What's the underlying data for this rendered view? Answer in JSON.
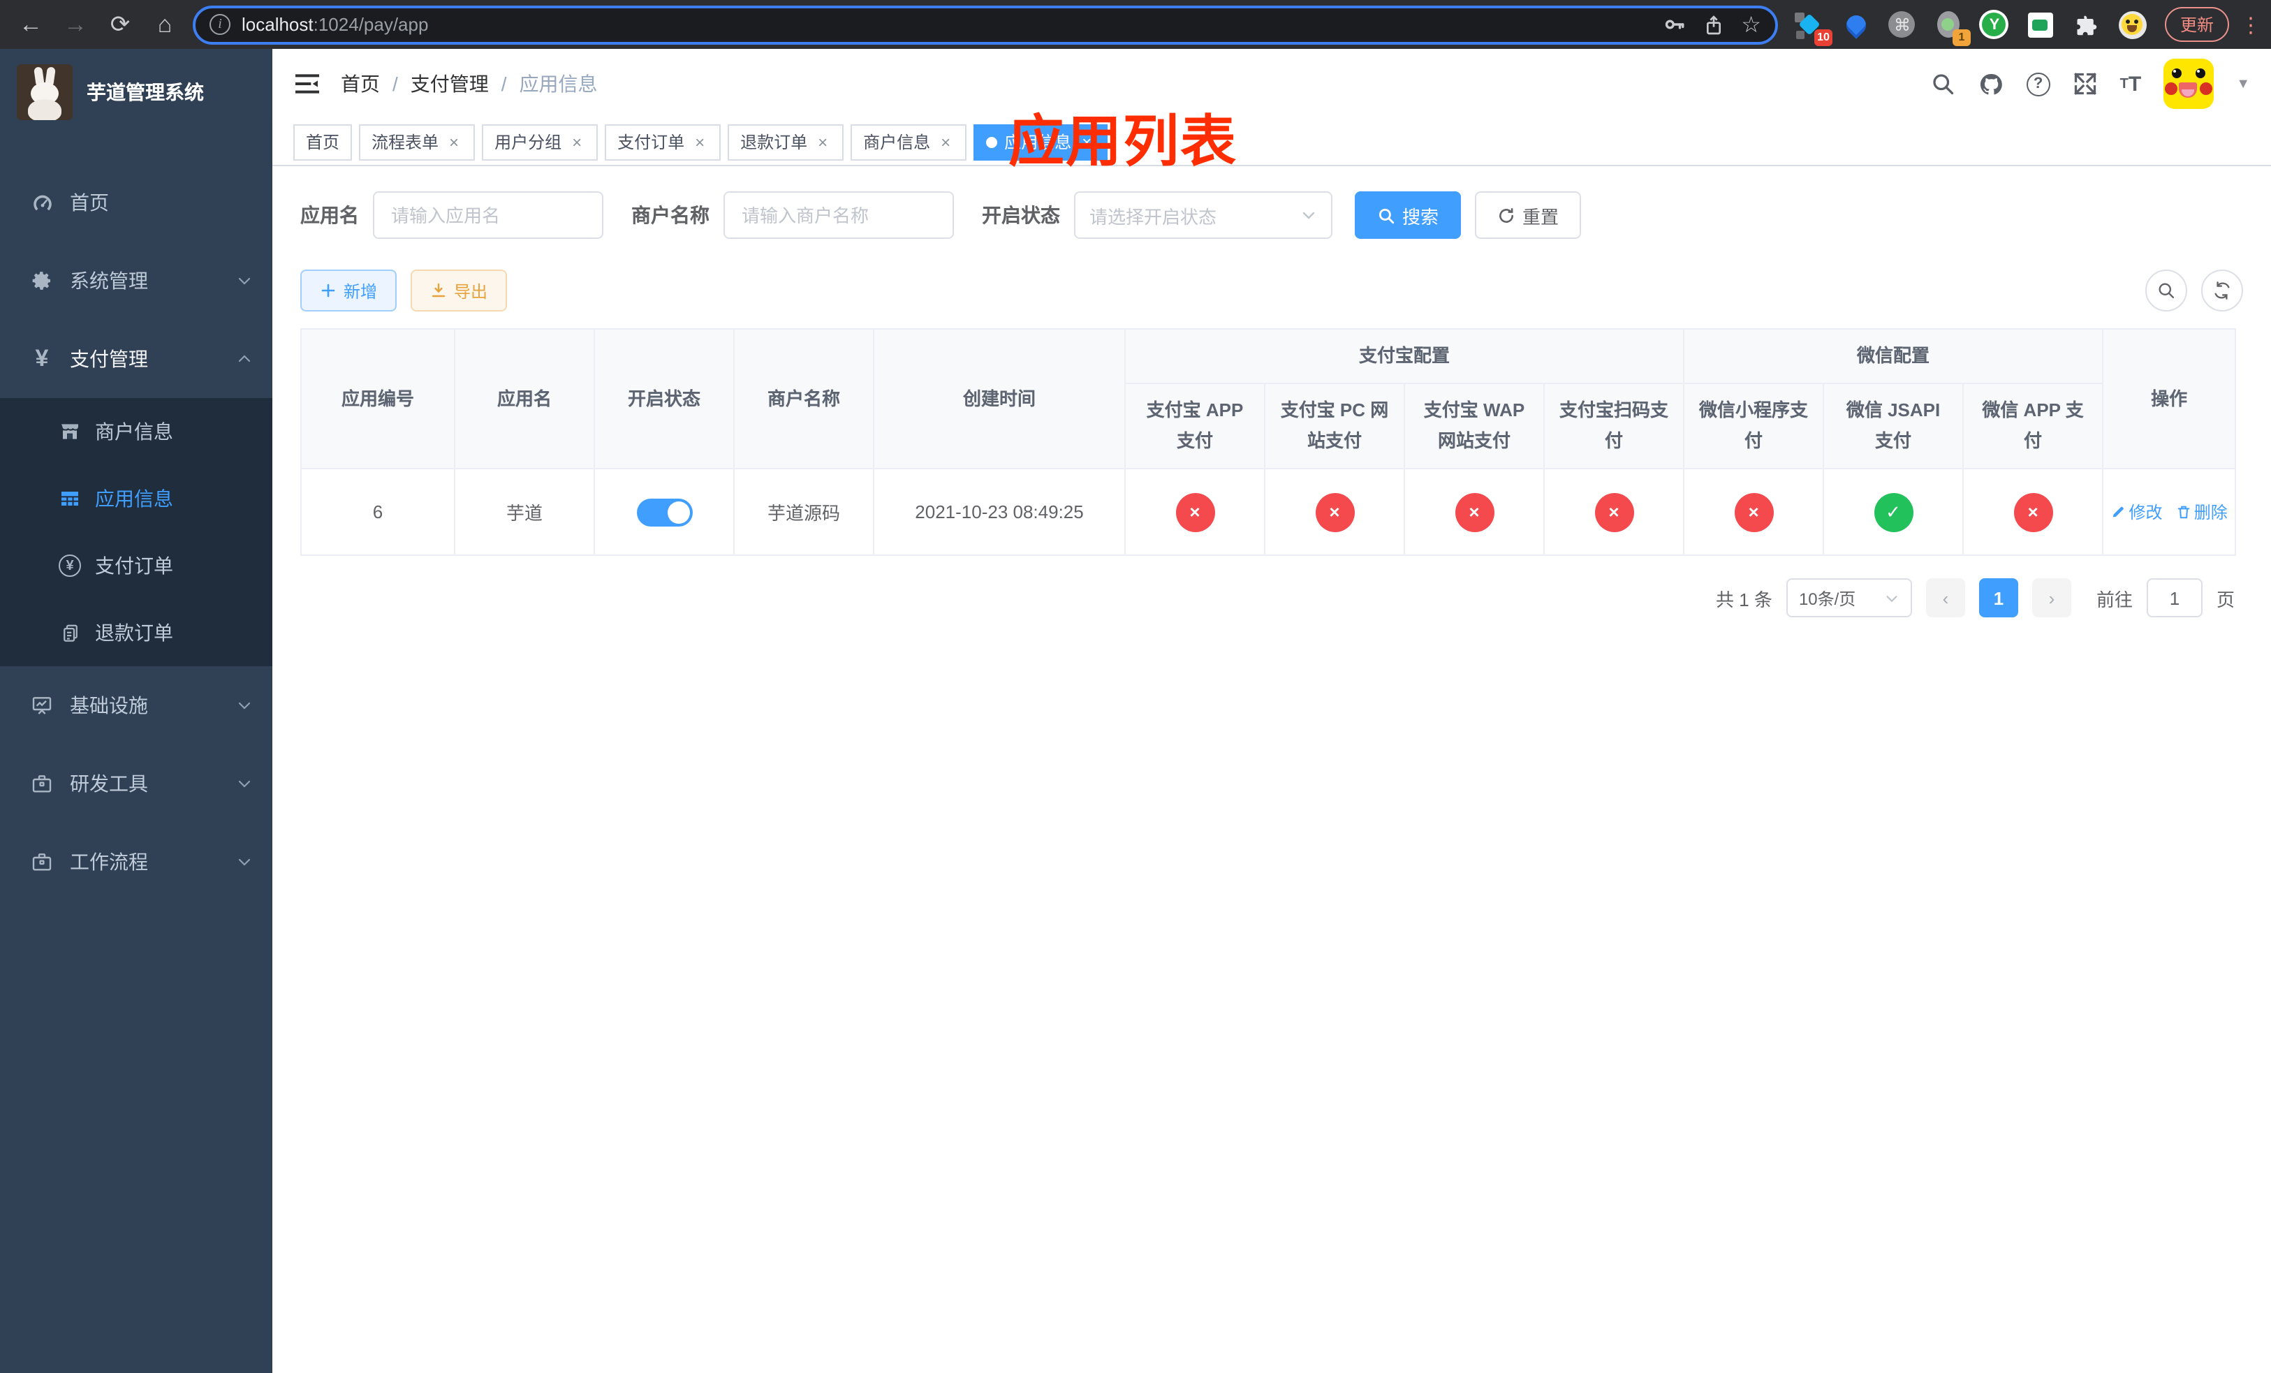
{
  "browser": {
    "url_host": "localhost",
    "url_rest": ":1024/pay/app",
    "update_button": "更新",
    "ext_badge_blue": "10",
    "ext_badge_green": "1",
    "toolbar_icons": [
      "back-icon",
      "forward-icon",
      "reload-icon",
      "home-icon",
      "info-icon",
      "key-icon",
      "share-icon",
      "star-icon",
      "extensions",
      "menu-kebab-icon"
    ]
  },
  "sidebar": {
    "title": "芋道管理系统",
    "items": [
      {
        "icon": "gauge",
        "label": "首页",
        "type": "item"
      },
      {
        "icon": "gear",
        "label": "系统管理",
        "type": "item",
        "chevron": "down"
      },
      {
        "icon": "yen",
        "label": "支付管理",
        "type": "item",
        "chevron": "up",
        "active_parent": true
      },
      {
        "icon": "store",
        "label": "商户信息",
        "type": "sub"
      },
      {
        "icon": "grid",
        "label": "应用信息",
        "type": "sub",
        "active": true
      },
      {
        "icon": "yen-circle",
        "label": "支付订单",
        "type": "sub"
      },
      {
        "icon": "doc",
        "label": "退款订单",
        "type": "sub"
      },
      {
        "icon": "monitor",
        "label": "基础设施",
        "type": "item",
        "chevron": "down"
      },
      {
        "icon": "briefcase",
        "label": "研发工具",
        "type": "item",
        "chevron": "down"
      },
      {
        "icon": "briefcase",
        "label": "工作流程",
        "type": "item",
        "chevron": "down"
      }
    ]
  },
  "header": {
    "breadcrumb": [
      "首页",
      "支付管理",
      "应用信息"
    ],
    "annotation": "应用列表",
    "right_icons": [
      "search-icon",
      "github-icon",
      "help-icon",
      "fullscreen-icon",
      "font-size-icon",
      "user-avatar",
      "chevron-down-icon"
    ]
  },
  "tabs": [
    {
      "label": "首页",
      "closable": false,
      "active": false
    },
    {
      "label": "流程表单",
      "closable": true,
      "active": false
    },
    {
      "label": "用户分组",
      "closable": true,
      "active": false
    },
    {
      "label": "支付订单",
      "closable": true,
      "active": false
    },
    {
      "label": "退款订单",
      "closable": true,
      "active": false
    },
    {
      "label": "商户信息",
      "closable": true,
      "active": false
    },
    {
      "label": "应用信息",
      "closable": true,
      "active": true
    }
  ],
  "filters": {
    "app_name_label": "应用名",
    "app_name_placeholder": "请输入应用名",
    "merchant_label": "商户名称",
    "merchant_placeholder": "请输入商户名称",
    "status_label": "开启状态",
    "status_placeholder": "请选择开启状态",
    "search_button": "搜索",
    "reset_button": "重置"
  },
  "actions": {
    "add": "新增",
    "export": "导出"
  },
  "table": {
    "columns": [
      "应用编号",
      "应用名",
      "开启状态",
      "商户名称",
      "创建时间"
    ],
    "groups": [
      {
        "label": "支付宝配置",
        "span": 4
      },
      {
        "label": "微信配置",
        "span": 3
      }
    ],
    "pay_columns": [
      "支付宝 APP 支付",
      "支付宝 PC 网站支付",
      "支付宝 WAP 网站支付",
      "支付宝扫码支付",
      "微信小程序支付",
      "微信 JSAPI 支付",
      "微信 APP 支付"
    ],
    "op_column": "操作",
    "row": {
      "id": "6",
      "name": "芋道",
      "enabled": true,
      "merchant": "芋道源码",
      "created": "2021-10-23 08:49:25",
      "statuses": [
        "x",
        "x",
        "x",
        "x",
        "x",
        "check",
        "x"
      ],
      "edit": "修改",
      "delete": "删除"
    }
  },
  "pagination": {
    "total": "共 1 条",
    "page_size": "10条/页",
    "page": "1",
    "goto_prefix": "前往",
    "goto_value": "1",
    "goto_suffix": "页"
  },
  "colors": {
    "accent": "#409eff",
    "status_off": "#f4494d",
    "status_on": "#22c15c",
    "annotation": "#ff2d00",
    "sidebar_bg": "#304156",
    "submenu_bg": "#1f2d3d"
  }
}
